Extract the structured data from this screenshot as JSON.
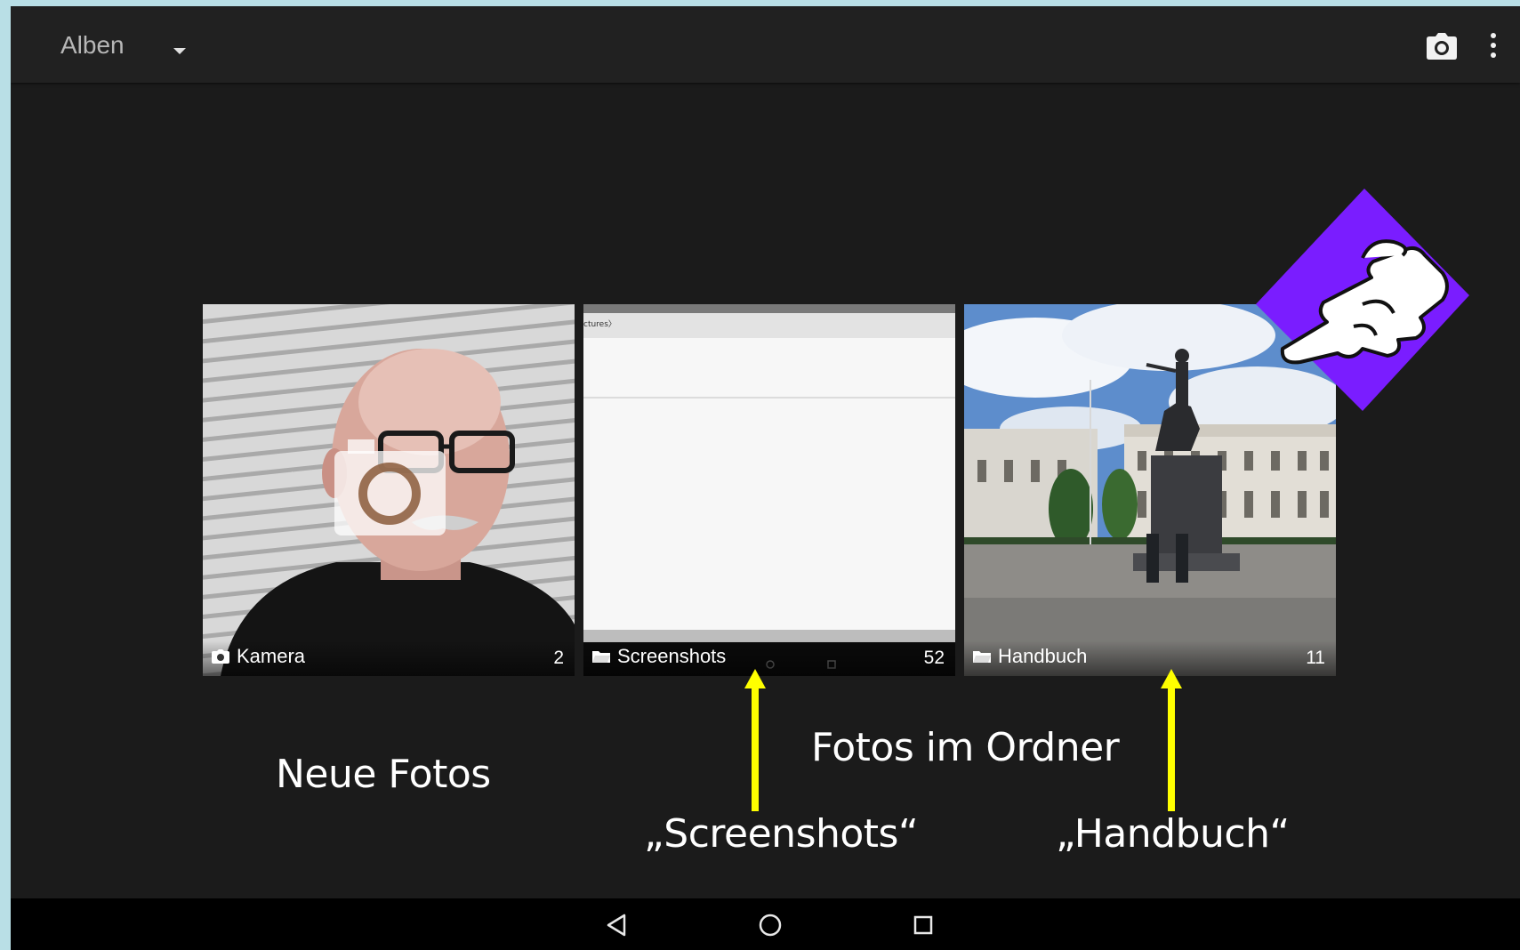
{
  "appbar": {
    "title": "Alben",
    "dropdown_icon": "caret-down-icon",
    "camera_icon": "camera-icon",
    "more_icon": "more-vert-icon"
  },
  "albums": [
    {
      "name": "Kamera",
      "count": "2",
      "type_icon": "camera-icon"
    },
    {
      "name": "Screenshots",
      "count": "52",
      "type_icon": "folder-icon"
    },
    {
      "name": "Handbuch",
      "count": "11",
      "type_icon": "folder-icon"
    }
  ],
  "annotations": {
    "new_photos": "Neue  Fotos",
    "photos_in_folder": "Fotos im Ordner",
    "screenshots_label": "„Screenshots“",
    "handbuch_label": "„Handbuch“",
    "arrow_color": "#ffff00"
  },
  "overlay": {
    "pointer_icon": "pointing-hand-icon",
    "badge_color": "#7a1dff"
  },
  "navbar": {
    "back_icon": "back-triangle-icon",
    "home_icon": "home-circle-icon",
    "recents_icon": "recents-square-icon"
  },
  "screenshot_thumb_text": "ctures〉"
}
